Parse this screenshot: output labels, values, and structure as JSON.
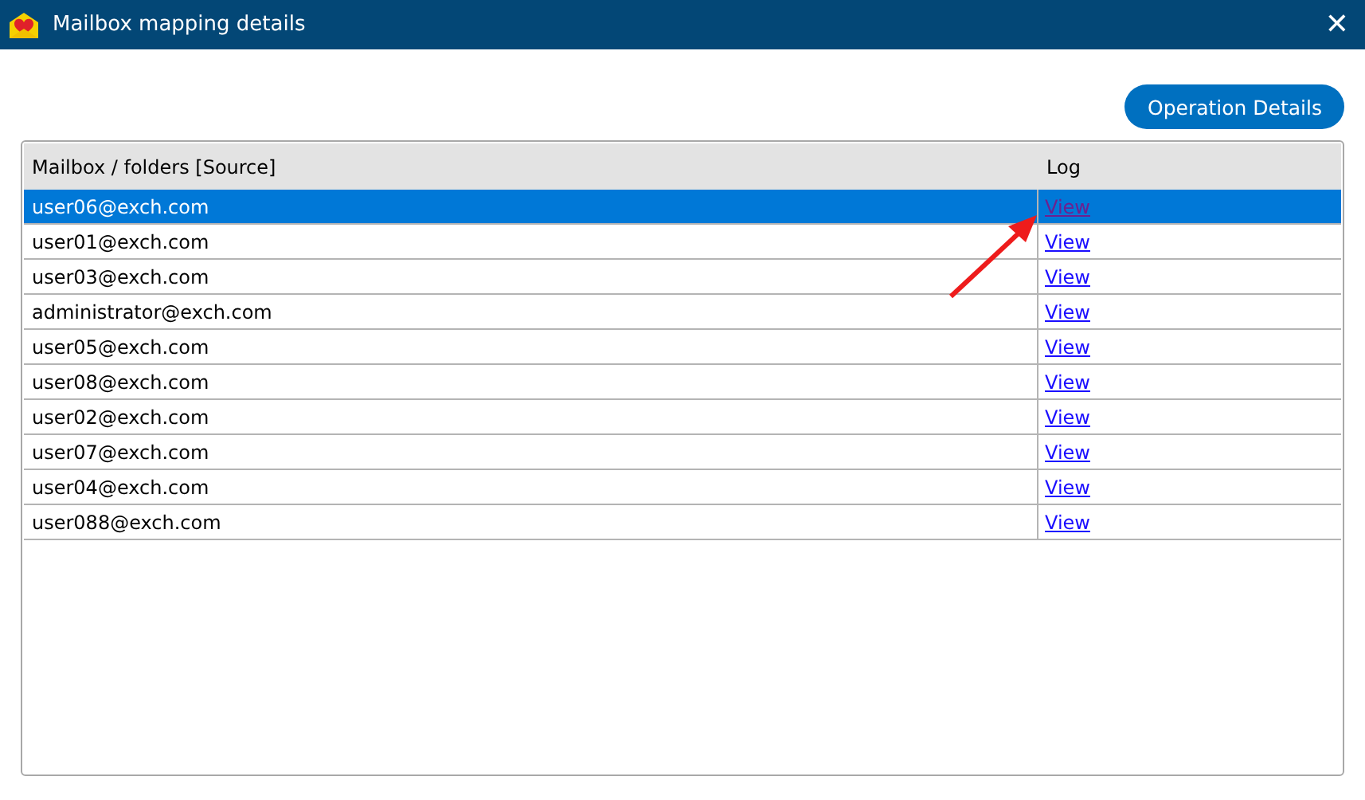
{
  "window": {
    "title": "Mailbox mapping details",
    "close": "✕"
  },
  "toolbar": {
    "button": "Operation Details"
  },
  "table": {
    "columns": [
      "Mailbox / folders [Source]",
      "Log"
    ],
    "rows": [
      {
        "mailbox": "user06@exch.com",
        "log": "View",
        "selected": true,
        "visited": true
      },
      {
        "mailbox": "user01@exch.com",
        "log": "View",
        "selected": false,
        "visited": false
      },
      {
        "mailbox": "user03@exch.com",
        "log": "View",
        "selected": false,
        "visited": false
      },
      {
        "mailbox": "administrator@exch.com",
        "log": "View",
        "selected": false,
        "visited": false
      },
      {
        "mailbox": "user05@exch.com",
        "log": "View",
        "selected": false,
        "visited": false
      },
      {
        "mailbox": "user08@exch.com",
        "log": "View",
        "selected": false,
        "visited": false
      },
      {
        "mailbox": "user02@exch.com",
        "log": "View",
        "selected": false,
        "visited": false
      },
      {
        "mailbox": "user07@exch.com",
        "log": "View",
        "selected": false,
        "visited": false
      },
      {
        "mailbox": "user04@exch.com",
        "log": "View",
        "selected": false,
        "visited": false
      },
      {
        "mailbox": "user088@exch.com",
        "log": "View",
        "selected": false,
        "visited": false
      }
    ]
  }
}
